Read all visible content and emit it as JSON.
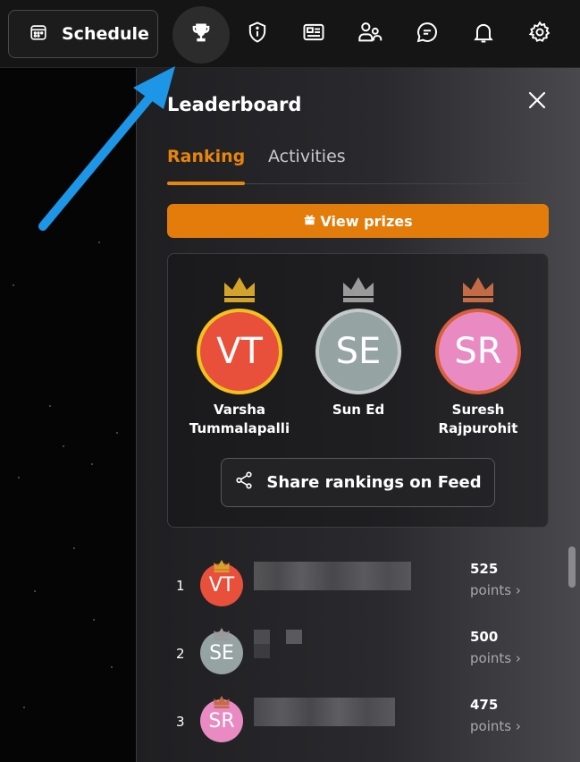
{
  "topbar": {
    "schedule_label": "Schedule",
    "icons": [
      "calendar-icon",
      "trophy-icon",
      "info-shield-icon",
      "newspaper-icon",
      "people-icon",
      "chat-icon",
      "bell-icon",
      "gear-icon"
    ]
  },
  "panel": {
    "title": "Leaderboard",
    "tabs": [
      {
        "label": "Ranking",
        "active": true
      },
      {
        "label": "Activities",
        "active": false
      }
    ],
    "view_prizes_label": "View prizes",
    "share_label": "Share rankings on Feed"
  },
  "podium": [
    {
      "initials": "VT",
      "name": "Varsha Tummalapalli",
      "color": "#e8503c",
      "ring": "#f2c21b",
      "crown": "#d4a42a"
    },
    {
      "initials": "SE",
      "name": "Sun Ed",
      "color": "#96a3a3",
      "ring": "#c2c9c9",
      "crown": "#9a9a9a"
    },
    {
      "initials": "SR",
      "name": "Suresh Rajpurohit",
      "color": "#e98bc2",
      "ring": "#d9603a",
      "crown": "#c46a45"
    }
  ],
  "rankings": [
    {
      "rank": "1",
      "initials": "VT",
      "color": "#e8503c",
      "crown": "#d4a42a",
      "points": "525",
      "points_label": "points"
    },
    {
      "rank": "2",
      "initials": "SE",
      "color": "#96a3a3",
      "crown": "#9a9a9a",
      "points": "500",
      "points_label": "points"
    },
    {
      "rank": "3",
      "initials": "SR",
      "color": "#e98bc2",
      "crown": "#c46a45",
      "points": "475",
      "points_label": "points"
    }
  ],
  "colors": {
    "accent": "#e8850c",
    "arrow": "#1e96e8"
  }
}
